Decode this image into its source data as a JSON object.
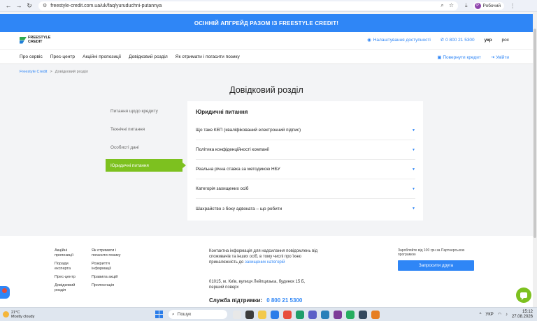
{
  "browser": {
    "url": "freestyle-credit.com.ua/uk/faq/yuruduchni-putannya",
    "profile_name": "Робочий",
    "profile_initial": "Р"
  },
  "banner": {
    "text": "ОСІННІЙ АПГРЕЙД РАЗОМ ІЗ FREESTYLE CREDIT!"
  },
  "header": {
    "logo_line1": "FREESTYLE",
    "logo_line2": "CREDIT",
    "accessibility": "Налаштування доступності",
    "phone": "0 800 21 5300",
    "lang_uk": "укр",
    "lang_ru": "рос"
  },
  "nav": {
    "items": [
      "Про сервіс",
      "Прес-центр",
      "Акційні пропозиції",
      "Довідковий розділ",
      "Як отримати і погасити позику"
    ],
    "repay": "Повернути кредит",
    "login": "Увійти"
  },
  "breadcrumb": {
    "home": "Freestyle Credit",
    "sep": ">",
    "current": "Довідковий розділ"
  },
  "page": {
    "title": "Довідковий розділ"
  },
  "side_menu": {
    "items": [
      "Питання щодо кредиту",
      "Технічні питання",
      "Особисті дані",
      "Юридичні питання"
    ]
  },
  "faq": {
    "title": "Юридичні питання",
    "items": [
      "Що таке КЕП (кваліфікований електронний підпис)",
      "Політика конфіденційності компанії",
      "Реальна річна ставка за методикою НБУ",
      "Категорія захищених осіб",
      "Шахрайство з боку адвоката – що робити"
    ]
  },
  "footer": {
    "col1": [
      "Акційні пропозиції",
      "Поради експерта",
      "Прес-центр",
      "Довідковий розділ"
    ],
    "col2": [
      "Як отримати і погасити позику",
      "Розкриття інформації",
      "Правила акцій",
      "Пролонгація"
    ],
    "contact_text": "Контактна інформація для надсилання повідомлень від споживачів та інших осіб, в тому числі про їхню приналежність до",
    "contact_link": "захищених категорій",
    "address": "01015, м. Київ, вулиця Лейпцизька, будинок 15 Б, перший поверх",
    "support_label": "Служба підтримки:",
    "support_phone": "0 800 21 5300",
    "invite_note": "Заробляйте від 100 грн за Партнерською програмою",
    "invite_button": "Запросити друга"
  },
  "taskbar": {
    "temp": "21°C",
    "weather": "Mostly cloudy",
    "search": "Пошук",
    "lang": "УКР",
    "time": "15:12",
    "date": "27.08.2026"
  }
}
